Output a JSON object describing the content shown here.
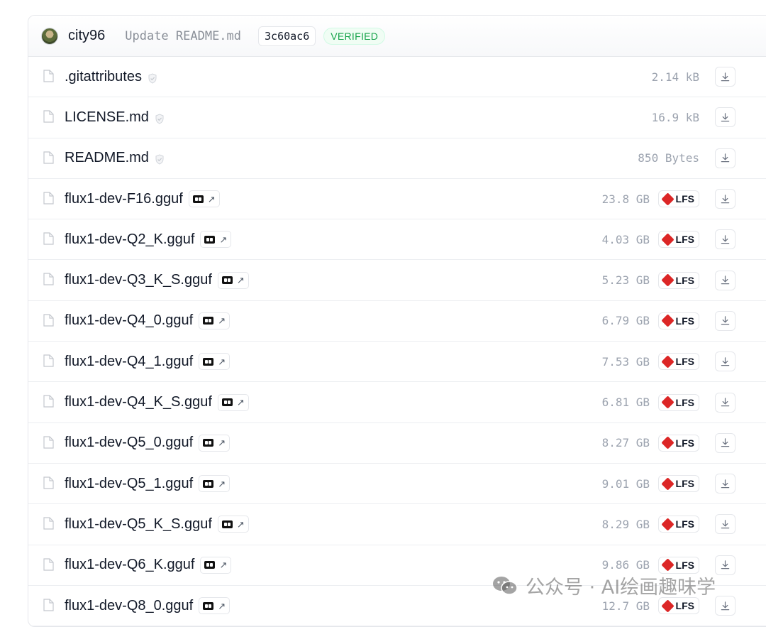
{
  "commit": {
    "author": "city96",
    "message": "Update README.md",
    "hash": "3c60ac6",
    "badge": "VERIFIED"
  },
  "files": [
    {
      "name": ".gitattributes",
      "size": "2.14 kB",
      "lfs": false,
      "type": "plain"
    },
    {
      "name": "LICENSE.md",
      "size": "16.9 kB",
      "lfs": false,
      "type": "plain"
    },
    {
      "name": "README.md",
      "size": "850 Bytes",
      "lfs": false,
      "type": "plain"
    },
    {
      "name": "flux1-dev-F16.gguf",
      "size": "23.8 GB",
      "lfs": true,
      "type": "gguf"
    },
    {
      "name": "flux1-dev-Q2_K.gguf",
      "size": "4.03 GB",
      "lfs": true,
      "type": "gguf"
    },
    {
      "name": "flux1-dev-Q3_K_S.gguf",
      "size": "5.23 GB",
      "lfs": true,
      "type": "gguf"
    },
    {
      "name": "flux1-dev-Q4_0.gguf",
      "size": "6.79 GB",
      "lfs": true,
      "type": "gguf"
    },
    {
      "name": "flux1-dev-Q4_1.gguf",
      "size": "7.53 GB",
      "lfs": true,
      "type": "gguf"
    },
    {
      "name": "flux1-dev-Q4_K_S.gguf",
      "size": "6.81 GB",
      "lfs": true,
      "type": "gguf"
    },
    {
      "name": "flux1-dev-Q5_0.gguf",
      "size": "8.27 GB",
      "lfs": true,
      "type": "gguf"
    },
    {
      "name": "flux1-dev-Q5_1.gguf",
      "size": "9.01 GB",
      "lfs": true,
      "type": "gguf"
    },
    {
      "name": "flux1-dev-Q5_K_S.gguf",
      "size": "8.29 GB",
      "lfs": true,
      "type": "gguf"
    },
    {
      "name": "flux1-dev-Q6_K.gguf",
      "size": "9.86 GB",
      "lfs": true,
      "type": "gguf"
    },
    {
      "name": "flux1-dev-Q8_0.gguf",
      "size": "12.7 GB",
      "lfs": true,
      "type": "gguf"
    }
  ],
  "lfs_label": "LFS",
  "pill_arrow": "↗",
  "watermark": "公众号 · AI绘画趣味学",
  "icons": {
    "file": "file-icon",
    "safe": "shield-icon",
    "gguf": "gguf-viewer-icon",
    "lfs": "lfs-icon",
    "download": "download-icon"
  },
  "colors": {
    "verified": "#16a34a",
    "lfs": "#dc2626",
    "muted": "#9ca3af"
  }
}
